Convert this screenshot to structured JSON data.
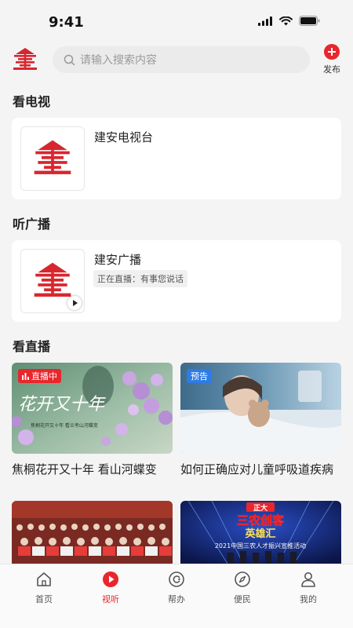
{
  "status_bar": {
    "time": "9:41"
  },
  "top_bar": {
    "search_placeholder": "请输入搜索内容",
    "publish_label": "发布"
  },
  "sections": {
    "tv_title": "看电视",
    "radio_title": "听广播",
    "live_title": "看直播"
  },
  "tv": {
    "name": "建安电视台"
  },
  "radio": {
    "name": "建安广播",
    "now_playing": "正在直播：有事您说话"
  },
  "live_items": [
    {
      "caption": "焦桐花开又十年 看山河蝶变",
      "badge": "直播中",
      "poster_text": "花开又十年",
      "poster_sub": "焦桐花开又十年 看兰考山河蝶变"
    },
    {
      "caption": "如何正确应对儿童呼吸道疾病",
      "badge": "预告"
    },
    {
      "caption": ""
    },
    {
      "caption": "",
      "poster_title1": "正大",
      "poster_title2": "三农创客",
      "poster_title3": "英雄汇",
      "poster_sub": "2021中国三农人才振兴宣推活动"
    }
  ],
  "tabs": [
    {
      "label": "首页",
      "icon": "home-icon"
    },
    {
      "label": "视听",
      "icon": "play-circle-icon",
      "active": true
    },
    {
      "label": "帮办",
      "icon": "help-icon"
    },
    {
      "label": "便民",
      "icon": "compass-icon"
    },
    {
      "label": "我的",
      "icon": "user-icon"
    }
  ],
  "colors": {
    "accent": "#e8262c",
    "preview": "#2f7be5"
  }
}
